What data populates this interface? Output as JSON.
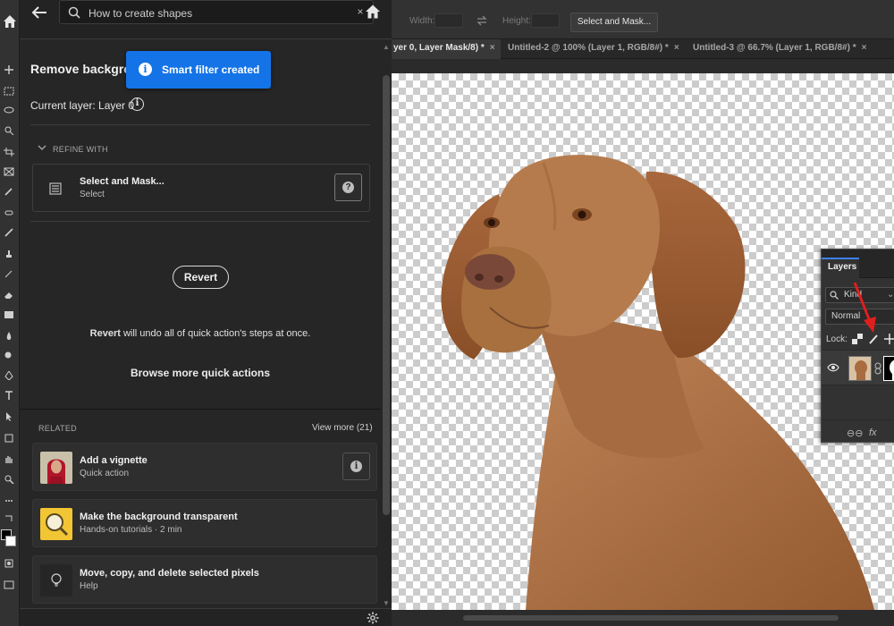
{
  "discover": {
    "search": {
      "value": "How to create shapes",
      "clear_glyph": "×"
    },
    "title": "Remove background",
    "toast": {
      "text": "Smart filter created",
      "icon_glyph": "i"
    },
    "current_layer": "Current layer: Layer 0",
    "info_glyph": "i",
    "refine_label": "REFINE WITH",
    "select_and_mask": {
      "title": "Select and Mask...",
      "subtitle": "Select",
      "help_glyph": "?"
    },
    "revert_button": "Revert",
    "revert_note_bold": "Revert",
    "revert_note_rest": " will undo all of quick action's steps at once.",
    "browse_link": "Browse more quick actions",
    "related": {
      "label": "RELATED",
      "view_more": "View more (21)",
      "items": [
        {
          "title": "Add a vignette",
          "subtitle": "Quick action",
          "info_glyph": "i"
        },
        {
          "title": "Make the background transparent",
          "subtitle": "Hands-on tutorials  ·  2 min"
        },
        {
          "title": "Move, copy, and delete selected pixels",
          "subtitle": "Help"
        }
      ]
    }
  },
  "options_bar": {
    "width_label": "Width:",
    "height_label": "Height:",
    "select_and_mask_button": "Select and Mask..."
  },
  "doc_tabs": [
    {
      "label": "yer 0, Layer Mask/8) *",
      "close": "×",
      "active": true
    },
    {
      "label": "Untitled-2 @ 100% (Layer 1, RGB/8#) *",
      "close": "×",
      "active": false
    },
    {
      "label": "Untitled-3 @ 66.7% (Layer 1, RGB/8#) *",
      "close": "×",
      "active": false
    }
  ],
  "layers_panel": {
    "tab": "Layers",
    "kind_filter": "Kind",
    "kind_chevron": "⌄",
    "blend_mode": "Normal",
    "lock_label": "Lock:",
    "footer_link": "⊖⊖",
    "footer_fx": "fx"
  },
  "colors": {
    "accent_blue": "#1473e6",
    "panel_bg": "#262626",
    "dog_fur": "#b0764c",
    "annotation_arrow": "#e01e1e"
  },
  "icons": [
    "home-icon",
    "back-arrow-icon",
    "search-icon",
    "close-icon",
    "info-icon",
    "chevron-down-icon",
    "select-mask-icon",
    "help-icon",
    "lightbulb-icon",
    "gear-icon",
    "swap-icon",
    "eye-icon",
    "chain-link-icon",
    "brush-icon",
    "move-icon",
    "checkerboard-icon"
  ]
}
